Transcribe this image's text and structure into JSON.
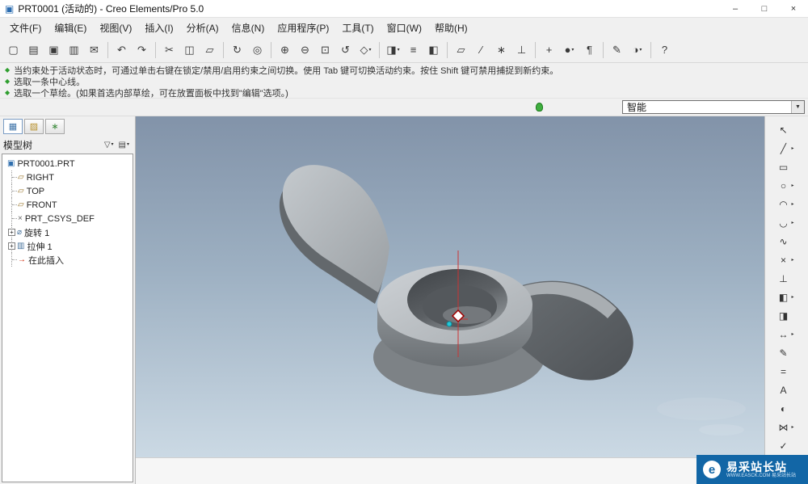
{
  "window": {
    "title": "PRT0001 (活动的) - Creo Elements/Pro 5.0",
    "controls": [
      {
        "name": "minimize-button",
        "glyph": "–"
      },
      {
        "name": "maximize-button",
        "glyph": "□"
      },
      {
        "name": "close-button",
        "glyph": "×"
      }
    ]
  },
  "menubar": {
    "items": [
      "文件(F)",
      "编辑(E)",
      "视图(V)",
      "插入(I)",
      "分析(A)",
      "信息(N)",
      "应用程序(P)",
      "工具(T)",
      "窗口(W)",
      "帮助(H)"
    ]
  },
  "toolbar": {
    "groups": [
      [
        {
          "name": "new-file-icon",
          "glyph": "▢"
        },
        {
          "name": "open-file-icon",
          "glyph": "▤"
        },
        {
          "name": "save-icon",
          "glyph": "▣"
        },
        {
          "name": "print-icon",
          "glyph": "▥"
        },
        {
          "name": "email-icon",
          "glyph": "✉"
        }
      ],
      [
        {
          "name": "undo-icon",
          "glyph": "↶"
        },
        {
          "name": "redo-icon",
          "glyph": "↷"
        }
      ],
      [
        {
          "name": "cut-icon",
          "glyph": "✂"
        },
        {
          "name": "copy-icon",
          "glyph": "◫"
        },
        {
          "name": "paste-icon",
          "glyph": "▱"
        }
      ],
      [
        {
          "name": "regenerate-icon",
          "glyph": "↻"
        },
        {
          "name": "find-icon",
          "glyph": "◎"
        }
      ],
      [
        {
          "name": "zoom-in-icon",
          "glyph": "⊕"
        },
        {
          "name": "zoom-out-icon",
          "glyph": "⊖"
        },
        {
          "name": "refit-icon",
          "glyph": "⊡"
        },
        {
          "name": "repaint-icon",
          "glyph": "↺"
        },
        {
          "name": "orient-icon",
          "glyph": "◇",
          "drop": true
        }
      ],
      [
        {
          "name": "saved-views-icon",
          "glyph": "◨",
          "drop": true
        },
        {
          "name": "layers-icon",
          "glyph": "≡"
        },
        {
          "name": "view-manager-icon",
          "glyph": "◧"
        }
      ],
      [
        {
          "name": "datum-planes-icon",
          "glyph": "▱"
        },
        {
          "name": "datum-axes-icon",
          "glyph": "∕"
        },
        {
          "name": "datum-points-icon",
          "glyph": "∗"
        },
        {
          "name": "datum-csys-icon",
          "glyph": "⊥"
        }
      ],
      [
        {
          "name": "spin-center-icon",
          "glyph": "+"
        },
        {
          "name": "display-style-icon",
          "glyph": "●",
          "drop": true
        },
        {
          "name": "annotation-icon",
          "glyph": "¶"
        }
      ],
      [
        {
          "name": "sketcher-icon",
          "glyph": "✎"
        },
        {
          "name": "appearance-icon",
          "glyph": "◑",
          "drop": true
        }
      ],
      [
        {
          "name": "context-help-icon",
          "glyph": "?"
        }
      ]
    ]
  },
  "messagebar": {
    "lines": [
      {
        "icon": "prompt-icon",
        "glyph": "◆",
        "text": "当约束处于活动状态时，可通过单击右键在锁定/禁用/启用约束之间切换。使用 Tab 键可切换活动约束。按住 Shift 键可禁用捕捉到新约束。"
      },
      {
        "icon": "prompt-icon",
        "glyph": "◆",
        "text": "选取一条中心线。"
      },
      {
        "icon": "prompt-icon",
        "glyph": "◆",
        "text": "选取一个草绘。(如果首选内部草绘，可在放置面板中找到\"编辑\"选项。)"
      }
    ]
  },
  "statusbar": {
    "filter_label": "智能"
  },
  "left_panel": {
    "tabs": [
      {
        "name": "tab-model-tree",
        "glyph": "▦",
        "color": "#3f74a8",
        "active": true
      },
      {
        "name": "tab-folder-browser",
        "glyph": "▨",
        "color": "#b8912c",
        "active": false
      },
      {
        "name": "tab-favorites",
        "glyph": "∗",
        "color": "#3a8a3a",
        "active": false
      }
    ],
    "header": {
      "title": "模型树",
      "buttons": [
        {
          "name": "show-filter-button",
          "glyph": "▽"
        },
        {
          "name": "tree-settings-button",
          "glyph": "▤"
        }
      ]
    }
  },
  "model_tree": {
    "items": [
      {
        "id": "prt0001",
        "label": "PRT0001.PRT",
        "icon": "part-icon",
        "glyph": "▣",
        "icon_color": "#2f6fae",
        "indent": 0
      },
      {
        "id": "right",
        "label": "RIGHT",
        "icon": "datum-plane-icon",
        "glyph": "▱",
        "icon_color": "#9a762a",
        "indent": 1
      },
      {
        "id": "top",
        "label": "TOP",
        "icon": "datum-plane-icon",
        "glyph": "▱",
        "icon_color": "#9a762a",
        "indent": 1
      },
      {
        "id": "front",
        "label": "FRONT",
        "icon": "datum-plane-icon",
        "glyph": "▱",
        "icon_color": "#9a762a",
        "indent": 1
      },
      {
        "id": "prt-csys-def",
        "label": "PRT_CSYS_DEF",
        "icon": "coordinate-system-icon",
        "glyph": "×",
        "icon_color": "#666666",
        "indent": 1
      },
      {
        "id": "revolve-1",
        "label": "旋转 1",
        "icon": "revolve-feature-icon",
        "glyph": "⌀",
        "icon_color": "#44709a",
        "indent": 1,
        "expandable": true
      },
      {
        "id": "extrude-1",
        "label": "拉伸 1",
        "icon": "extrude-feature-icon",
        "glyph": "▥",
        "icon_color": "#44709a",
        "indent": 1,
        "expandable": true
      },
      {
        "id": "insert-here",
        "label": "在此插入",
        "icon": "insert-here-icon",
        "glyph": "→",
        "icon_color": "#cc2200",
        "indent": 1
      }
    ]
  },
  "right_toolbar": {
    "icons": [
      {
        "name": "select-arrow-icon",
        "glyph": "↖"
      },
      {
        "name": "line-icon",
        "glyph": "╱",
        "drop": true
      },
      {
        "name": "rectangle-icon",
        "glyph": "▭"
      },
      {
        "name": "circle-icon",
        "glyph": "○",
        "drop": true
      },
      {
        "name": "arc-icon",
        "glyph": "◠",
        "drop": true
      },
      {
        "name": "fillet-icon",
        "glyph": "◡",
        "drop": true
      },
      {
        "name": "spline-icon",
        "glyph": "∿"
      },
      {
        "name": "point-icon",
        "glyph": "×",
        "drop": true
      },
      {
        "name": "coordinate-system-icon",
        "glyph": "⊥"
      },
      {
        "name": "use-edge-icon",
        "glyph": "◧",
        "drop": true
      },
      {
        "name": "offset-edge-icon",
        "glyph": "◨"
      },
      {
        "name": "dimension-icon",
        "glyph": "↔",
        "drop": true
      },
      {
        "name": "modify-dimension-icon",
        "glyph": "✎"
      },
      {
        "name": "constraint-icon",
        "glyph": "="
      },
      {
        "name": "text-icon",
        "glyph": "A"
      },
      {
        "name": "palette-icon",
        "glyph": "◐"
      },
      {
        "name": "mirror-trim-icon",
        "glyph": "⋈",
        "drop": true
      },
      {
        "name": "done-icon",
        "glyph": "✓"
      },
      {
        "name": "cancel-icon",
        "glyph": "✗"
      }
    ]
  },
  "watermark": {
    "logo_letter": "e",
    "title": "易采站长站",
    "subtitle": "WWW.EASCK.COM 易采站长站"
  },
  "colors": {
    "viewport_top": "#8293a9",
    "viewport_bottom": "#cbd9e4",
    "watermark_bg": "#1266a6",
    "centerline_red": "#cc3333",
    "prompt_green": "#2e9e2e"
  }
}
